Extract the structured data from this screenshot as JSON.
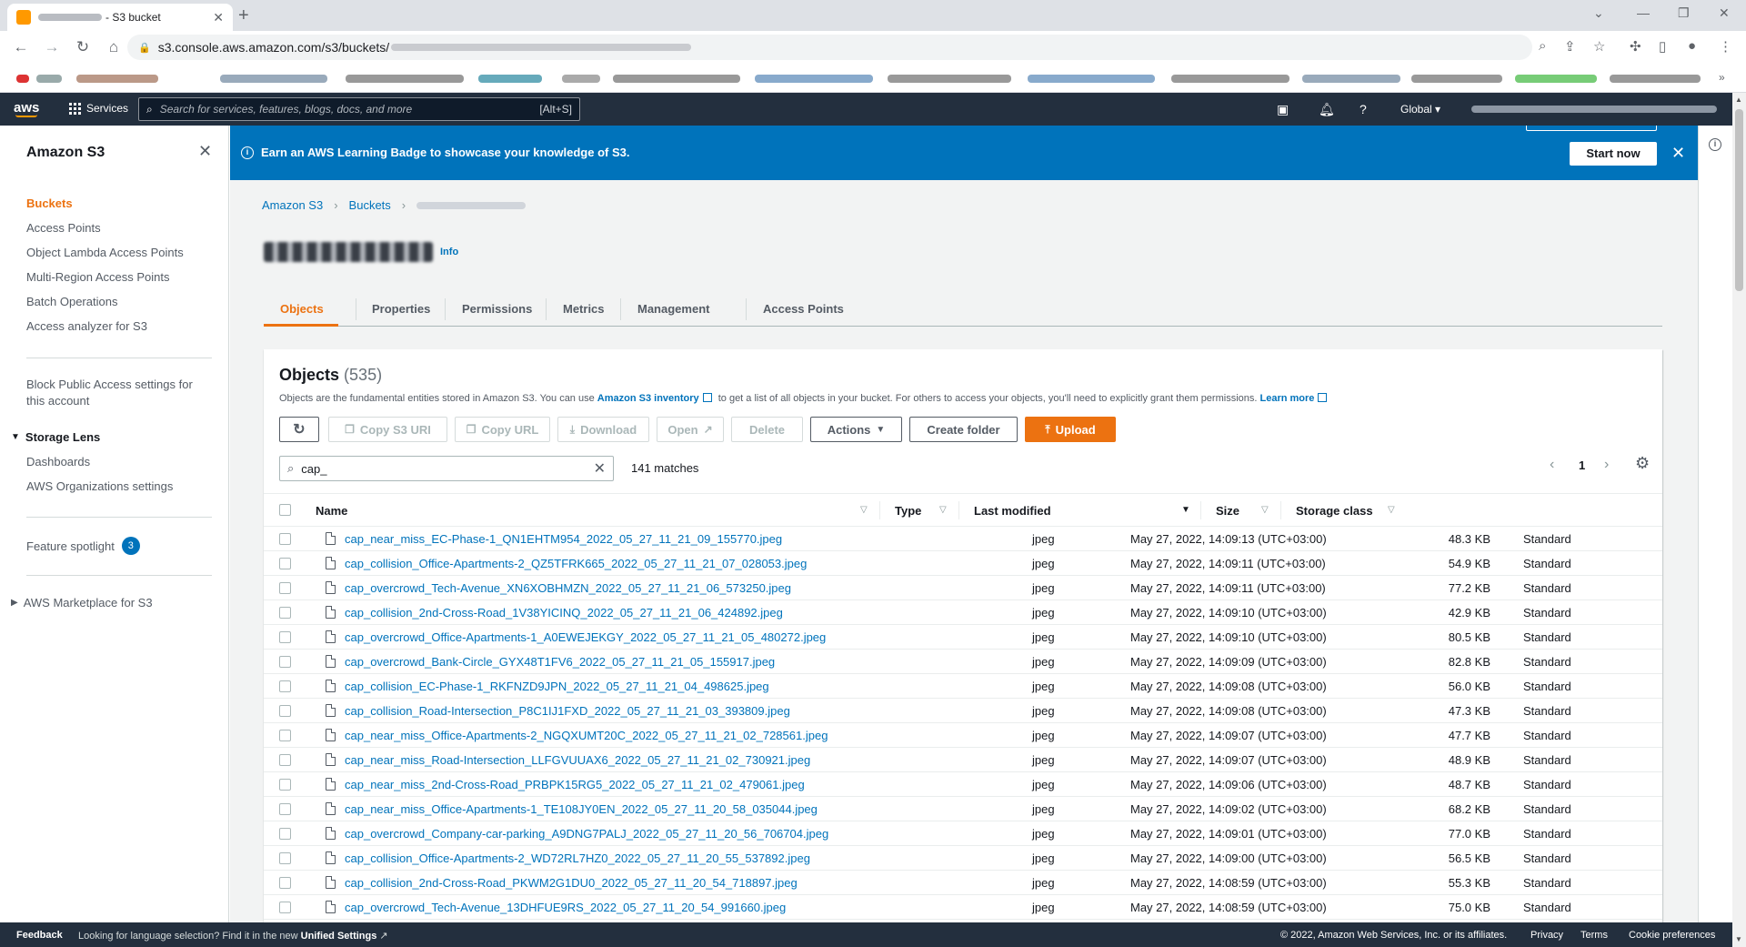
{
  "browser": {
    "tab_title": "- S3 bucket",
    "url_prefix": "s3.console.aws.amazon.com/s3/buckets/"
  },
  "awsnav": {
    "services_label": "Services",
    "search_placeholder": "Search for services, features, blogs, docs, and more",
    "search_shortcut": "[Alt+S]",
    "region_label": "Global ▾"
  },
  "sidebar": {
    "title": "Amazon S3",
    "items": [
      {
        "label": "Buckets"
      },
      {
        "label": "Access Points"
      },
      {
        "label": "Object Lambda Access Points"
      },
      {
        "label": "Multi-Region Access Points"
      },
      {
        "label": "Batch Operations"
      },
      {
        "label": "Access analyzer for S3"
      }
    ],
    "block_public_line1": "Block Public Access settings for",
    "block_public_line2": "this account",
    "storage_lens": {
      "title": "Storage Lens",
      "items": [
        {
          "label": "Dashboards"
        },
        {
          "label": "AWS Organizations settings"
        }
      ]
    },
    "feature_spotlight": "Feature spotlight",
    "feature_badge": "3",
    "marketplace": "AWS Marketplace for S3"
  },
  "flash": {
    "message": "Earn an AWS Learning Badge to showcase your knowledge of S3.",
    "start_label": "Start now"
  },
  "breadcrumbs": {
    "items": [
      {
        "label": "Amazon S3"
      },
      {
        "label": "Buckets"
      }
    ]
  },
  "bucket": {
    "info_label": "Info"
  },
  "tabs": [
    {
      "label": "Objects"
    },
    {
      "label": "Properties"
    },
    {
      "label": "Permissions"
    },
    {
      "label": "Metrics"
    },
    {
      "label": "Management"
    },
    {
      "label": "Access Points"
    }
  ],
  "objects": {
    "title": "Objects",
    "count": "(535)",
    "desc_part1": "Objects are the fundamental entities stored in Amazon S3. You can use",
    "desc_link1": "Amazon S3 inventory",
    "desc_part2": "to get a list of all objects in your bucket. For others to access your objects, you'll need to explicitly grant them permissions.",
    "desc_link2": "Learn more",
    "buttons": {
      "copy_uri": "Copy S3 URI",
      "copy_url": "Copy URL",
      "download": "Download",
      "open": "Open",
      "delete": "Delete",
      "actions": "Actions",
      "create_folder": "Create folder",
      "upload": "Upload"
    },
    "filter_value": "cap_",
    "matches": "141 matches",
    "page": "1",
    "columns": {
      "name": "Name",
      "type": "Type",
      "modified": "Last modified",
      "size": "Size",
      "storage": "Storage class"
    },
    "rows": [
      {
        "name": "cap_near_miss_EC-Phase-1_QN1EHTM954_2022_05_27_11_21_09_155770.jpeg",
        "type": "jpeg",
        "modified": "May 27, 2022, 14:09:13 (UTC+03:00)",
        "size": "48.3 KB",
        "storage": "Standard"
      },
      {
        "name": "cap_collision_Office-Apartments-2_QZ5TFRK665_2022_05_27_11_21_07_028053.jpeg",
        "type": "jpeg",
        "modified": "May 27, 2022, 14:09:11 (UTC+03:00)",
        "size": "54.9 KB",
        "storage": "Standard"
      },
      {
        "name": "cap_overcrowd_Tech-Avenue_XN6XOBHMZN_2022_05_27_11_21_06_573250.jpeg",
        "type": "jpeg",
        "modified": "May 27, 2022, 14:09:11 (UTC+03:00)",
        "size": "77.2 KB",
        "storage": "Standard"
      },
      {
        "name": "cap_collision_2nd-Cross-Road_1V38YICINQ_2022_05_27_11_21_06_424892.jpeg",
        "type": "jpeg",
        "modified": "May 27, 2022, 14:09:10 (UTC+03:00)",
        "size": "42.9 KB",
        "storage": "Standard"
      },
      {
        "name": "cap_overcrowd_Office-Apartments-1_A0EWEJEKGY_2022_05_27_11_21_05_480272.jpeg",
        "type": "jpeg",
        "modified": "May 27, 2022, 14:09:10 (UTC+03:00)",
        "size": "80.5 KB",
        "storage": "Standard"
      },
      {
        "name": "cap_overcrowd_Bank-Circle_GYX48T1FV6_2022_05_27_11_21_05_155917.jpeg",
        "type": "jpeg",
        "modified": "May 27, 2022, 14:09:09 (UTC+03:00)",
        "size": "82.8 KB",
        "storage": "Standard"
      },
      {
        "name": "cap_collision_EC-Phase-1_RKFNZD9JPN_2022_05_27_11_21_04_498625.jpeg",
        "type": "jpeg",
        "modified": "May 27, 2022, 14:09:08 (UTC+03:00)",
        "size": "56.0 KB",
        "storage": "Standard"
      },
      {
        "name": "cap_collision_Road-Intersection_P8C1IJ1FXD_2022_05_27_11_21_03_393809.jpeg",
        "type": "jpeg",
        "modified": "May 27, 2022, 14:09:08 (UTC+03:00)",
        "size": "47.3 KB",
        "storage": "Standard"
      },
      {
        "name": "cap_near_miss_Office-Apartments-2_NGQXUMT20C_2022_05_27_11_21_02_728561.jpeg",
        "type": "jpeg",
        "modified": "May 27, 2022, 14:09:07 (UTC+03:00)",
        "size": "47.7 KB",
        "storage": "Standard"
      },
      {
        "name": "cap_near_miss_Road-Intersection_LLFGVUUAX6_2022_05_27_11_21_02_730921.jpeg",
        "type": "jpeg",
        "modified": "May 27, 2022, 14:09:07 (UTC+03:00)",
        "size": "48.9 KB",
        "storage": "Standard"
      },
      {
        "name": "cap_near_miss_2nd-Cross-Road_PRBPK15RG5_2022_05_27_11_21_02_479061.jpeg",
        "type": "jpeg",
        "modified": "May 27, 2022, 14:09:06 (UTC+03:00)",
        "size": "48.7 KB",
        "storage": "Standard"
      },
      {
        "name": "cap_near_miss_Office-Apartments-1_TE108JY0EN_2022_05_27_11_20_58_035044.jpeg",
        "type": "jpeg",
        "modified": "May 27, 2022, 14:09:02 (UTC+03:00)",
        "size": "68.2 KB",
        "storage": "Standard"
      },
      {
        "name": "cap_overcrowd_Company-car-parking_A9DNG7PALJ_2022_05_27_11_20_56_706704.jpeg",
        "type": "jpeg",
        "modified": "May 27, 2022, 14:09:01 (UTC+03:00)",
        "size": "77.0 KB",
        "storage": "Standard"
      },
      {
        "name": "cap_collision_Office-Apartments-2_WD72RL7HZ0_2022_05_27_11_20_55_537892.jpeg",
        "type": "jpeg",
        "modified": "May 27, 2022, 14:09:00 (UTC+03:00)",
        "size": "56.5 KB",
        "storage": "Standard"
      },
      {
        "name": "cap_collision_2nd-Cross-Road_PKWM2G1DU0_2022_05_27_11_20_54_718897.jpeg",
        "type": "jpeg",
        "modified": "May 27, 2022, 14:08:59 (UTC+03:00)",
        "size": "55.3 KB",
        "storage": "Standard"
      },
      {
        "name": "cap_overcrowd_Tech-Avenue_13DHFUE9RS_2022_05_27_11_20_54_991660.jpeg",
        "type": "jpeg",
        "modified": "May 27, 2022, 14:08:59 (UTC+03:00)",
        "size": "75.0 KB",
        "storage": "Standard"
      }
    ]
  },
  "footer": {
    "feedback": "Feedback",
    "lang_text": "Looking for language selection? Find it in the new",
    "lang_link": "Unified Settings",
    "copyright": "© 2022, Amazon Web Services, Inc. or its affiliates.",
    "privacy": "Privacy",
    "terms": "Terms",
    "cookies": "Cookie preferences"
  }
}
